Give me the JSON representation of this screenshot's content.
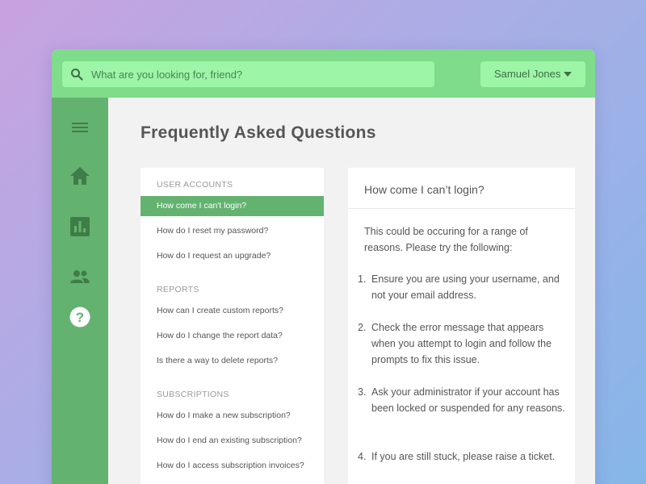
{
  "search": {
    "placeholder": "What are you looking for, friend?"
  },
  "user": {
    "name": "Samuel Jones"
  },
  "sidebar": {
    "icons": [
      "menu-icon",
      "home-icon",
      "reports-icon",
      "users-icon",
      "help-icon"
    ]
  },
  "page": {
    "title": "Frequently Asked Questions"
  },
  "faq": {
    "categories": [
      {
        "title": "USER ACCOUNTS",
        "questions": [
          "How come I can't login?",
          "How do I reset my password?",
          "How do I request an upgrade?"
        ]
      },
      {
        "title": "REPORTS",
        "questions": [
          "How can I create custom reports?",
          "How do I change the report data?",
          "Is there a way to delete reports?"
        ]
      },
      {
        "title": "SUBSCRIPTIONS",
        "questions": [
          "How do I make a new subscription?",
          "How do I end an existing subscription?",
          "How do I access subscription invoices?"
        ]
      }
    ],
    "active_question": "How come I can't login?"
  },
  "answer": {
    "title": "How come I can’t login?",
    "intro": "This could be occuring for a range of reasons. Please try the following:",
    "steps": [
      {
        "num": "1.",
        "text": "Ensure you are using your username, and not your email address."
      },
      {
        "num": "2.",
        "text": "Check the error message that appears when you attempt to login and follow the prompts to fix this issue."
      },
      {
        "num": "3.",
        "text": "Ask your administrator if your account has been locked or suspended for any reasons."
      },
      {
        "num": "4.",
        "text": "If you are still stuck, please raise a ticket."
      }
    ]
  },
  "colors": {
    "topbar": "#7fdc8a",
    "search_bg": "#9df5a7",
    "sidebar": "#64b270",
    "active_item": "#64b270"
  }
}
